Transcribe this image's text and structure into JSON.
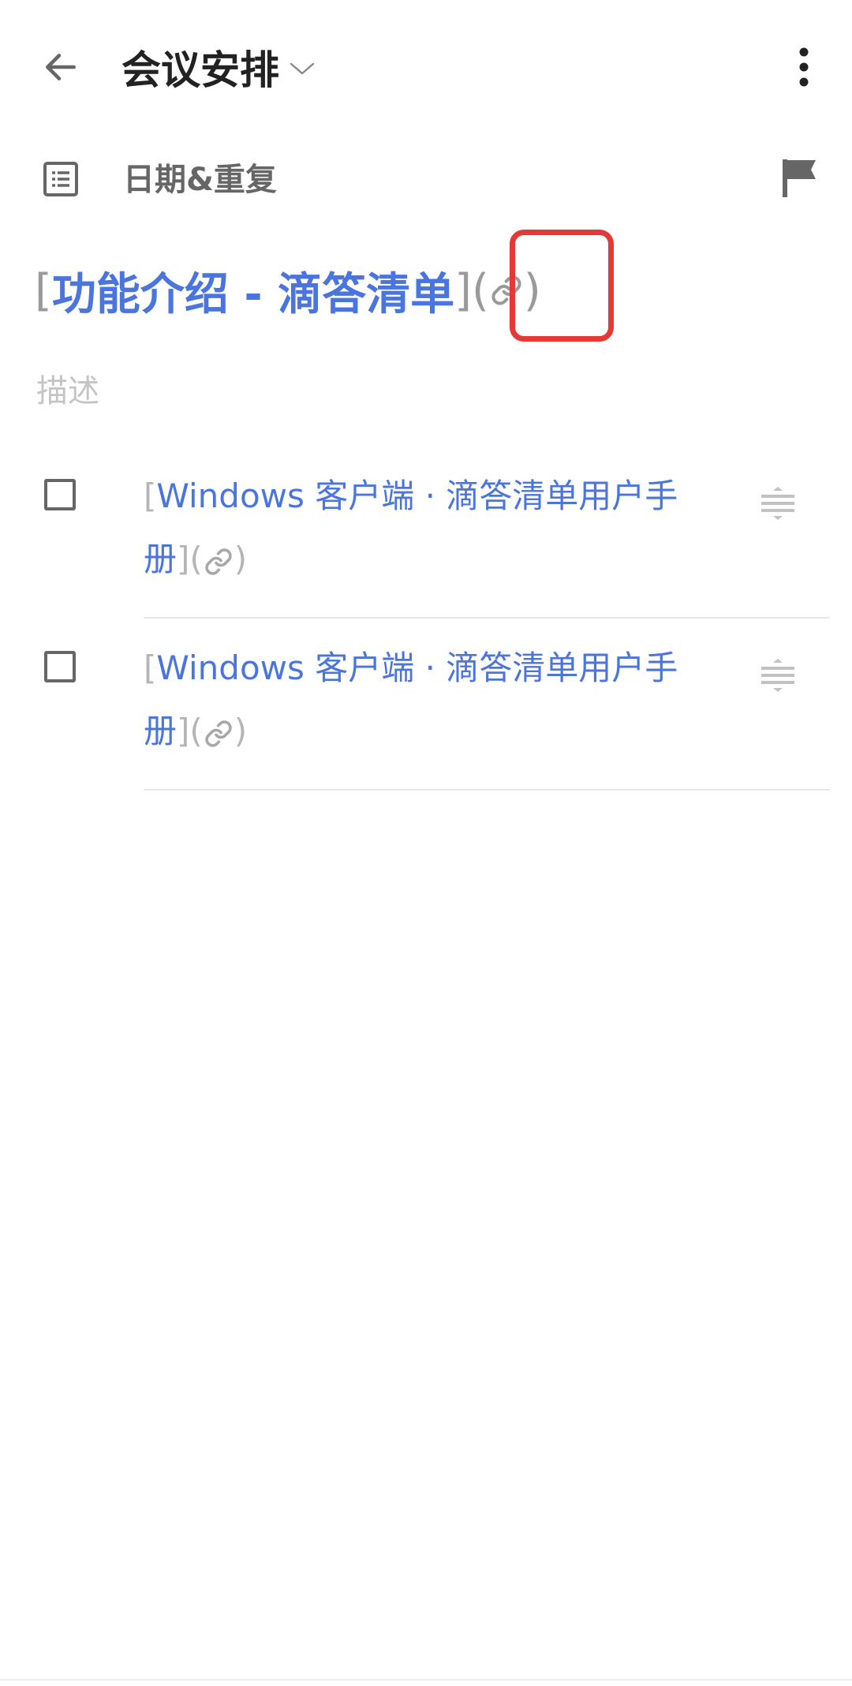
{
  "header": {
    "list_title": "会议安排",
    "back_icon": "arrow-left-icon",
    "dropdown_icon": "chevron-down-icon",
    "more_icon": "more-vertical-icon"
  },
  "date_row": {
    "type_icon": "text-document-icon",
    "label": "日期&重复",
    "flag_icon": "flag-icon"
  },
  "task": {
    "title_open_bracket": "[",
    "title_link_text": "功能介绍 - 滴答清单",
    "title_close_bracket": "]",
    "link_open_paren": "(",
    "link_icon": "link-icon",
    "link_close_paren": ")",
    "description_placeholder": "描述"
  },
  "checklist": [
    {
      "open_bracket": "[",
      "link_text": "Windows 客户端 · 滴答清单用户手册",
      "close_bracket": "]",
      "open_paren": "(",
      "close_paren": ")",
      "checked": false
    },
    {
      "open_bracket": "[",
      "link_text": "Windows 客户端 · 滴答清单用户手册",
      "close_bracket": "]",
      "open_paren": "(",
      "close_paren": ")",
      "checked": false
    }
  ],
  "colors": {
    "link": "#4a74de",
    "markdown_symbol": "#9a9a9a",
    "highlight": "#e53935",
    "placeholder": "#c4c4c4"
  }
}
